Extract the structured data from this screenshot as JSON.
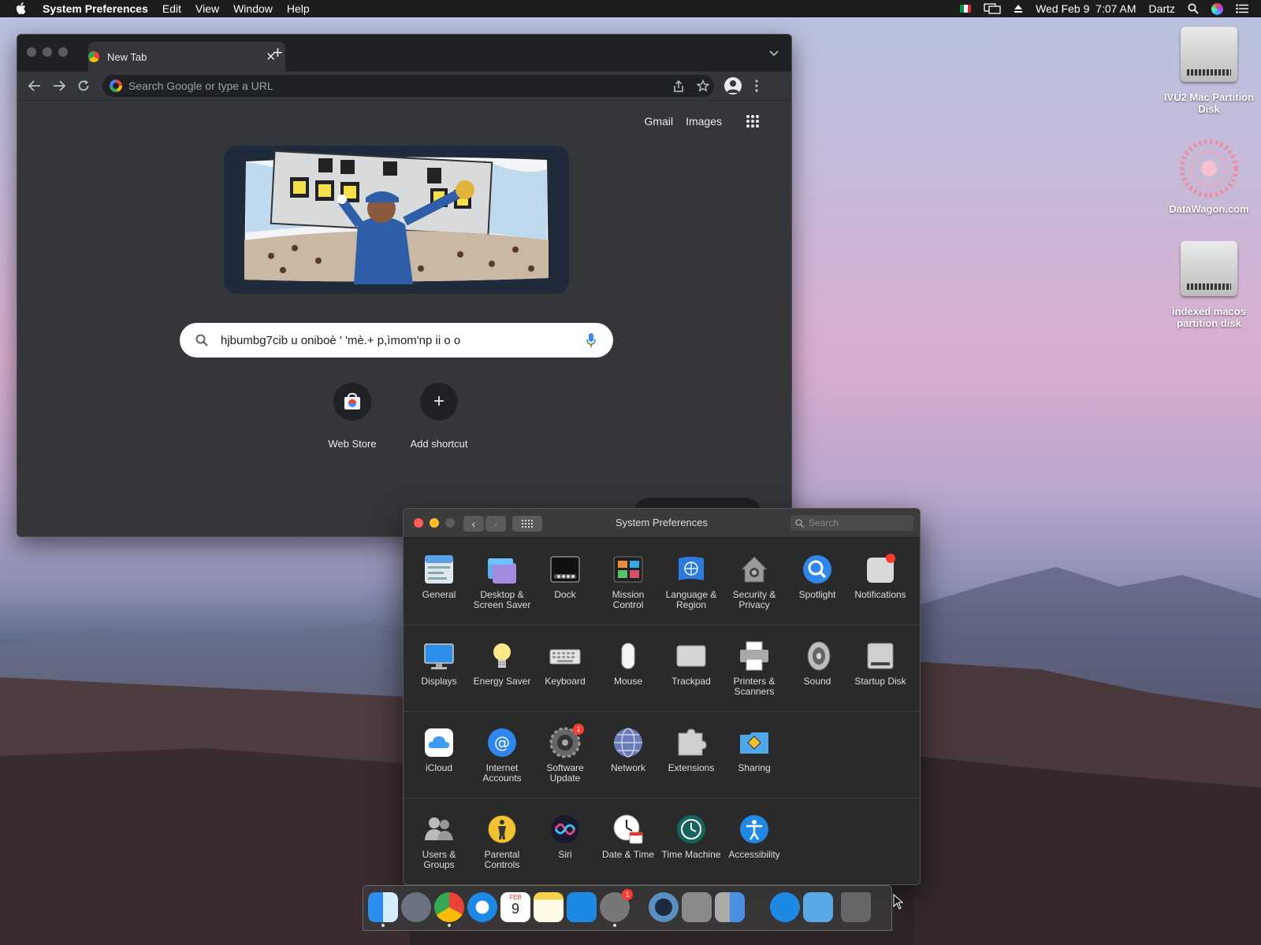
{
  "menubar": {
    "app": "System Preferences",
    "menus": [
      "Edit",
      "View",
      "Window",
      "Help"
    ],
    "clock": "Wed Feb 9  7:07 AM",
    "user": "Dartz"
  },
  "desktop": {
    "icons": [
      {
        "label": "IVU2 Mac Partition Disk"
      },
      {
        "label": "DataWagon.com"
      },
      {
        "label": "indexed macos partition disk"
      }
    ]
  },
  "chrome": {
    "tab_title": "New Tab",
    "omnibox_placeholder": "Search Google or type a URL",
    "links": {
      "gmail": "Gmail",
      "images": "Images"
    },
    "search_query": "hjbumbg7cib u oniboè ' 'mè.+ p,ìmom'np ii o o",
    "shortcuts": [
      {
        "label": "Web Store"
      },
      {
        "label": "Add shortcut"
      }
    ]
  },
  "sysprefs": {
    "title": "System Preferences",
    "search_placeholder": "Search",
    "rows": [
      [
        "General",
        "Desktop & Screen Saver",
        "Dock",
        "Mission Control",
        "Language & Region",
        "Security & Privacy",
        "Spotlight",
        "Notifications"
      ],
      [
        "Displays",
        "Energy Saver",
        "Keyboard",
        "Mouse",
        "Trackpad",
        "Printers & Scanners",
        "Sound",
        "Startup Disk"
      ],
      [
        "iCloud",
        "Internet Accounts",
        "Software Update",
        "Network",
        "Extensions",
        "Sharing"
      ],
      [
        "Users & Groups",
        "Parental Controls",
        "Siri",
        "Date & Time",
        "Time Machine",
        "Accessibility"
      ]
    ],
    "badges": {
      "software_update": "1"
    }
  },
  "dock": {
    "calendar_day": "9",
    "calendar_month": "FEB",
    "sysprefs_badge": "1"
  }
}
